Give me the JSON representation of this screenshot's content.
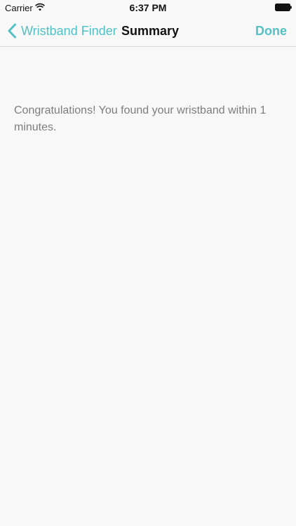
{
  "status_bar": {
    "carrier": "Carrier",
    "time": "6:37 PM",
    "wifi_icon": "wifi-icon",
    "battery_icon": "battery-icon"
  },
  "nav": {
    "back_label": "Wristband Finder",
    "back_icon": "chevron-left-icon",
    "title": "Summary",
    "done_label": "Done",
    "accent_color": "#53c0c4"
  },
  "content": {
    "message": "Congratulations! You found your wristband within 1 minutes."
  }
}
